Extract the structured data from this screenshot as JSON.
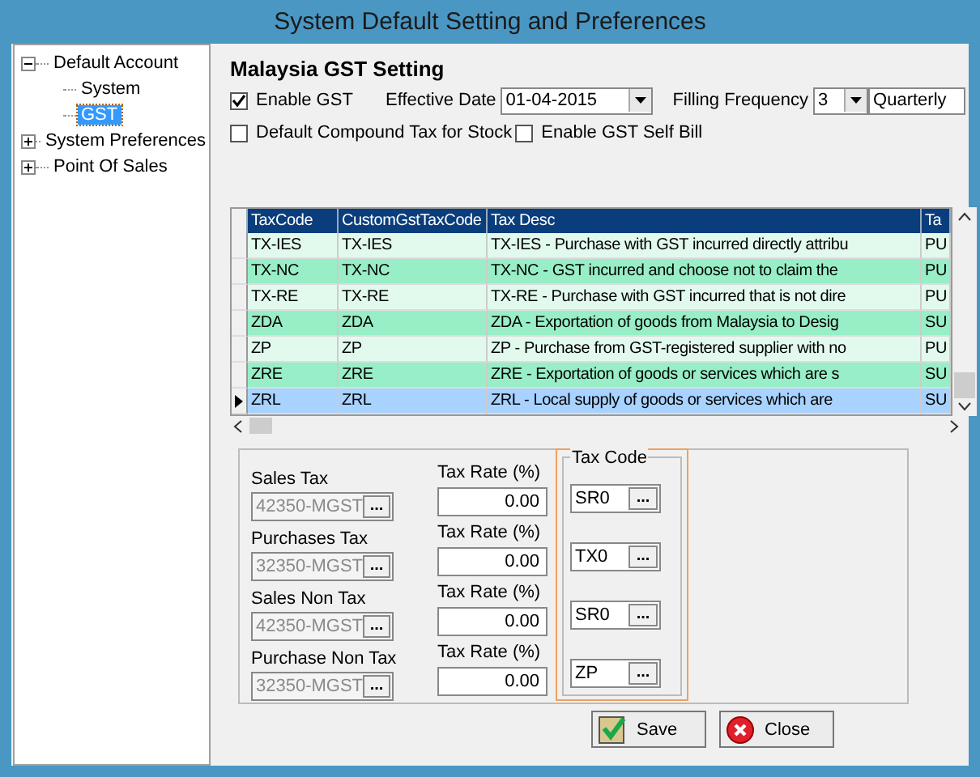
{
  "window": {
    "title": "System Default Setting and Preferences"
  },
  "tree": [
    {
      "label": "Default Account",
      "expanded": true,
      "selected": false,
      "children": [
        {
          "label": "System",
          "selected": false
        },
        {
          "label": "GST",
          "selected": true
        }
      ]
    },
    {
      "label": "System Preferences",
      "expanded": false,
      "selected": false
    },
    {
      "label": "Point Of Sales",
      "expanded": false,
      "selected": false
    }
  ],
  "heading": "Malaysia GST Setting",
  "enable_gst": {
    "label": "Enable GST",
    "checked": true
  },
  "effective_date": {
    "label": "Effective Date",
    "value": "01-04-2015"
  },
  "filling_frequency": {
    "label": "Filling Frequency",
    "value": "3",
    "period": "Quarterly"
  },
  "options": [
    {
      "label": "Default Compound Tax for Stock",
      "checked": false
    },
    {
      "label": "Enable GST Self Bill",
      "checked": false
    }
  ],
  "table": {
    "columns": [
      "TaxCode",
      "CustomGstTaxCode",
      "Tax Desc",
      "Ta"
    ],
    "rows": [
      {
        "cells": [
          "TX-IES",
          "TX-IES",
          "TX-IES - Purchase with GST incurred directly attribu",
          "PU"
        ],
        "selected": false
      },
      {
        "cells": [
          "TX-NC",
          "TX-NC",
          "TX-NC - GST incurred and choose not to claim the",
          "PU"
        ],
        "selected": false
      },
      {
        "cells": [
          "TX-RE",
          "TX-RE",
          "TX-RE - Purchase with GST incurred that is not dire",
          "PU"
        ],
        "selected": false
      },
      {
        "cells": [
          "ZDA",
          "ZDA",
          "ZDA - Exportation of goods from Malaysia to Desig",
          "SU"
        ],
        "selected": false
      },
      {
        "cells": [
          "ZP",
          "ZP",
          "ZP - Purchase from GST-registered supplier with no",
          "PU"
        ],
        "selected": false
      },
      {
        "cells": [
          "ZRE",
          "ZRE",
          "ZRE - Exportation of goods or services which are s",
          "SU"
        ],
        "selected": false
      },
      {
        "cells": [
          "ZRL",
          "ZRL",
          "ZRL - Local supply of goods or services which are",
          "SU"
        ],
        "selected": true
      }
    ]
  },
  "accounts": [
    {
      "label": "Sales Tax",
      "account": "42350-MGST",
      "account_button": "...",
      "disabled": true,
      "rate_label": "Tax Rate (%)",
      "rate": "0.00"
    },
    {
      "label": "Purchases Tax",
      "account": "32350-MGST",
      "account_button": "...",
      "disabled": true,
      "rate_label": "Tax Rate (%)",
      "rate": "0.00"
    },
    {
      "label": "Sales Non Tax",
      "account": "42350-MGST",
      "account_button": "...",
      "disabled": true,
      "rate_label": "Tax Rate (%)",
      "rate": "0.00"
    },
    {
      "label": "Purchase Non Tax",
      "account": "32350-MGST",
      "account_button": "...",
      "disabled": true,
      "rate_label": "Tax Rate (%)",
      "rate": "0.00"
    }
  ],
  "tax_code_group": {
    "title": "Tax Code",
    "codes": [
      {
        "value": "SR0",
        "button": "..."
      },
      {
        "value": "TX0",
        "button": "..."
      },
      {
        "value": "SR0",
        "button": "..."
      },
      {
        "value": "ZP",
        "button": "..."
      }
    ]
  },
  "buttons": [
    {
      "label": "Save",
      "kind": "save"
    },
    {
      "label": "Close",
      "kind": "close"
    }
  ]
}
